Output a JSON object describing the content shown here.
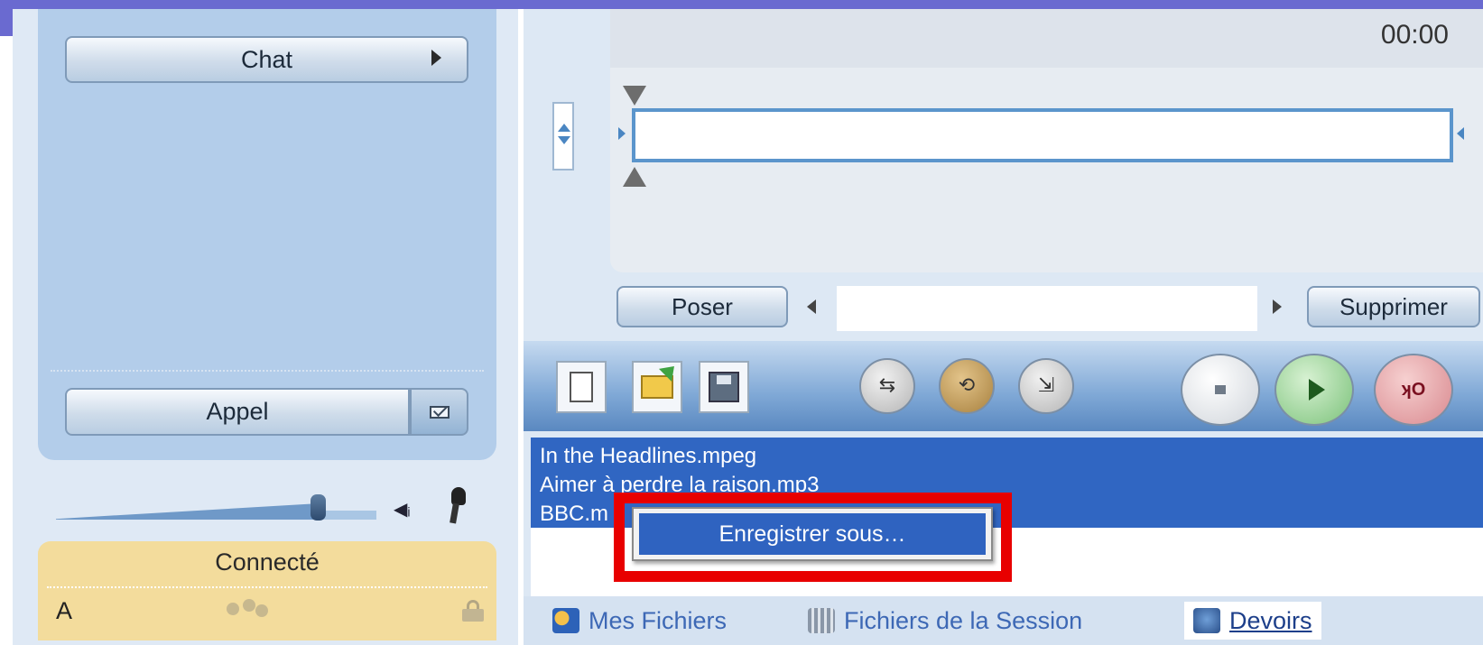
{
  "left_panel": {
    "chat_label": "Chat",
    "call_label": "Appel",
    "volume_level": 0.84,
    "status_label": "Connecté",
    "status_letter": "A"
  },
  "timeline": {
    "time": "00:00",
    "poser_label": "Poser",
    "supprimer_label": "Supprimer",
    "seek_value": ""
  },
  "toolbar": {
    "icons": [
      "new-document-icon",
      "open-folder-icon",
      "save-disk-icon",
      "swap-icon",
      "loop-icon",
      "export-icon",
      "stop-icon",
      "play-icon",
      "record-icon"
    ]
  },
  "file_list": {
    "items": [
      "In the Headlines.mpeg",
      "Aimer à perdre la raison.mp3",
      "BBC.m"
    ]
  },
  "context_menu": {
    "save_as": "Enregistrer sous…"
  },
  "tabs": [
    {
      "label": "Mes Fichiers"
    },
    {
      "label": "Fichiers de la Session"
    },
    {
      "label": "Devoirs"
    }
  ],
  "colors": {
    "selection": "#3066c2",
    "highlight": "#e80000",
    "accent": "#6a6ad0"
  }
}
